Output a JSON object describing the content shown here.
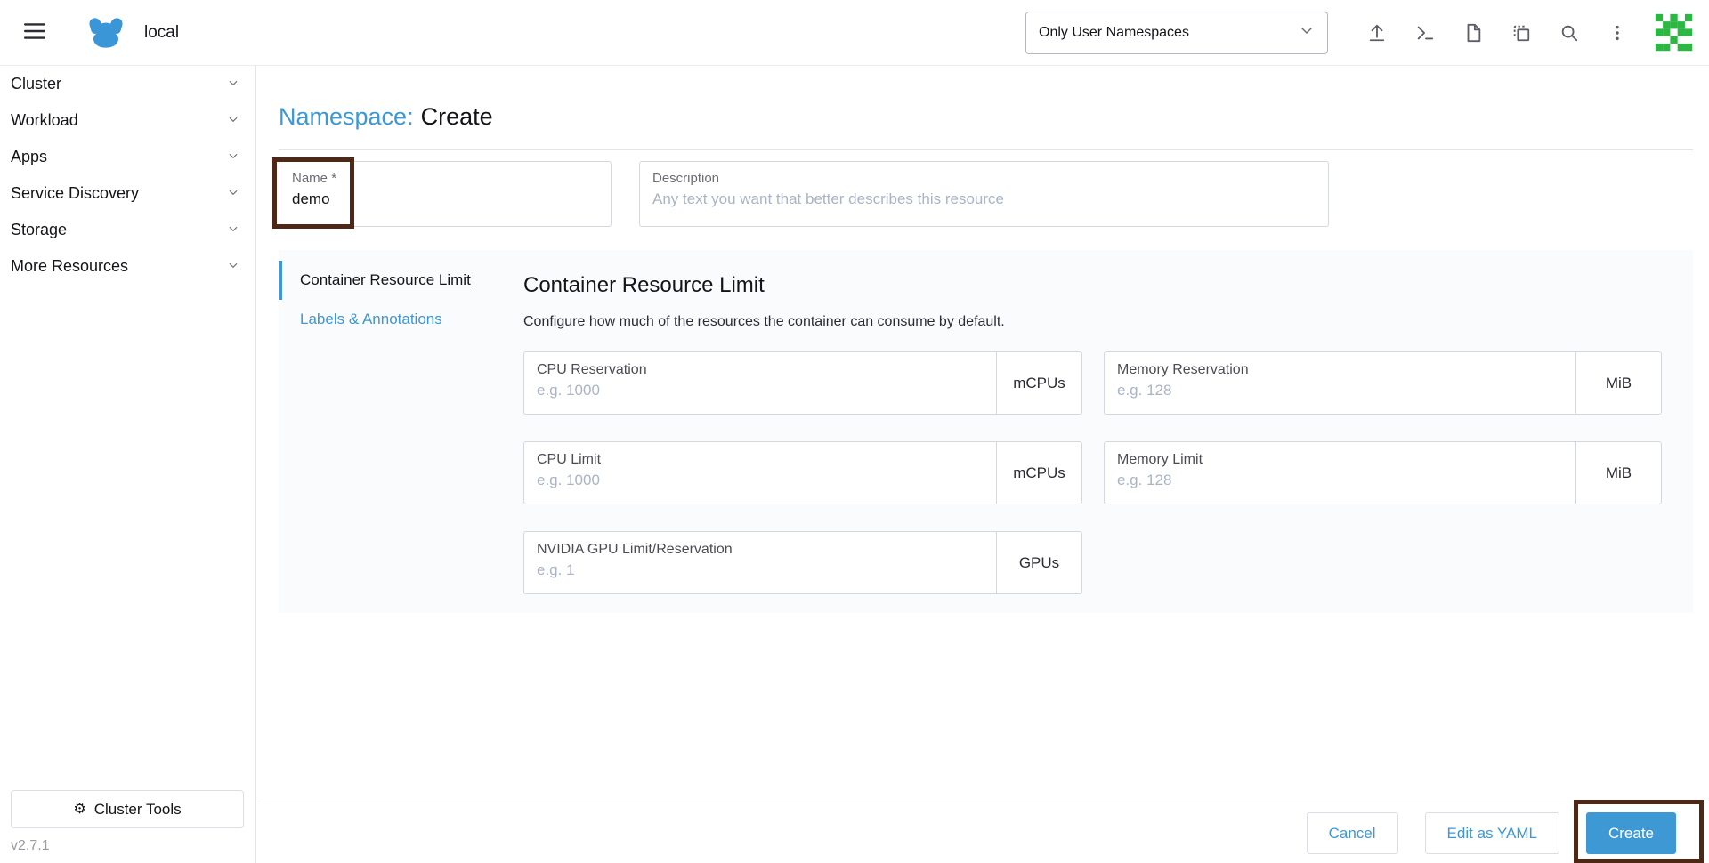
{
  "colors": {
    "accent": "#3d98d3",
    "annotation": "#4e2817",
    "text_dark": "#141419",
    "text_muted": "#6c6c76",
    "placeholder": "#aab4c4",
    "avatar_green": "#2cb742"
  },
  "header": {
    "cluster_name": "local",
    "namespace_filter_selected": "Only User Namespaces",
    "icons": [
      "menu-icon",
      "rancher-logo",
      "chevron-down-icon",
      "import-yaml-icon",
      "kubectl-shell-icon",
      "kubeconfig-file-icon",
      "copy-kubeconfig-icon",
      "search-icon",
      "kebab-menu-icon",
      "user-avatar"
    ]
  },
  "sidebar": {
    "items": [
      {
        "label": "Cluster"
      },
      {
        "label": "Workload"
      },
      {
        "label": "Apps"
      },
      {
        "label": "Service Discovery"
      },
      {
        "label": "Storage"
      },
      {
        "label": "More Resources"
      }
    ],
    "cluster_tools_label": "Cluster Tools",
    "version": "v2.7.1"
  },
  "page": {
    "title_prefix": "Namespace:",
    "title_action": "Create"
  },
  "form": {
    "name": {
      "label": "Name",
      "required_mark": "*",
      "value": "demo"
    },
    "description": {
      "label": "Description",
      "placeholder": "Any text you want that better describes this resource"
    }
  },
  "tabs": [
    {
      "label": "Container Resource Limit",
      "active": true
    },
    {
      "label": "Labels & Annotations",
      "active": false
    }
  ],
  "section": {
    "title": "Container Resource Limit",
    "subtitle": "Configure how much of the resources the container can consume by default.",
    "fields": [
      {
        "label": "CPU Reservation",
        "placeholder": "e.g. 1000",
        "suffix": "mCPUs"
      },
      {
        "label": "Memory Reservation",
        "placeholder": "e.g. 128",
        "suffix": "MiB"
      },
      {
        "label": "CPU Limit",
        "placeholder": "e.g. 1000",
        "suffix": "mCPUs"
      },
      {
        "label": "Memory Limit",
        "placeholder": "e.g. 128",
        "suffix": "MiB"
      },
      {
        "label": "NVIDIA GPU Limit/Reservation",
        "placeholder": "e.g. 1",
        "suffix": "GPUs"
      }
    ]
  },
  "footer": {
    "cancel_label": "Cancel",
    "edit_yaml_label": "Edit as YAML",
    "create_label": "Create"
  }
}
